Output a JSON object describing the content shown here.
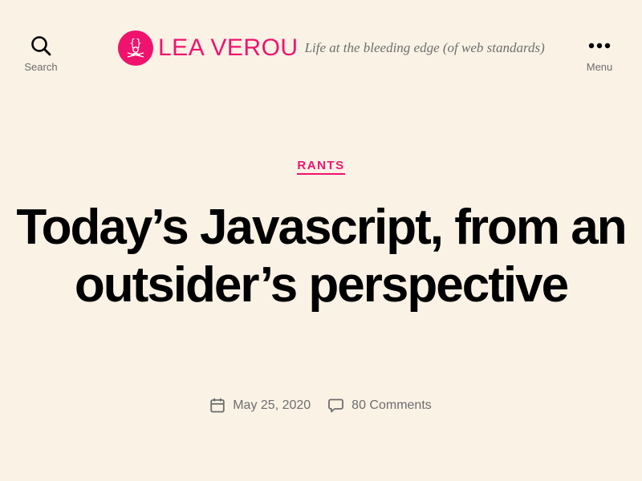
{
  "header": {
    "search_label": "Search",
    "menu_label": "Menu",
    "site_title": "LEA VEROU",
    "site_description": "Life at the bleeding edge (of web standards)"
  },
  "post": {
    "category": "RANTS",
    "title": "Today’s Javascript, from an outsider’s perspective",
    "date": "May 25, 2020",
    "comments": "80 Comments"
  },
  "colors": {
    "accent": "#f0136e",
    "background": "#fbf2e6",
    "text": "#000000",
    "muted": "#6d6d6d"
  },
  "icons": {
    "search": "search-icon",
    "menu": "ellipsis-icon",
    "logo": "site-logo-icon",
    "date": "calendar-icon",
    "comments": "comment-bubble-icon"
  }
}
